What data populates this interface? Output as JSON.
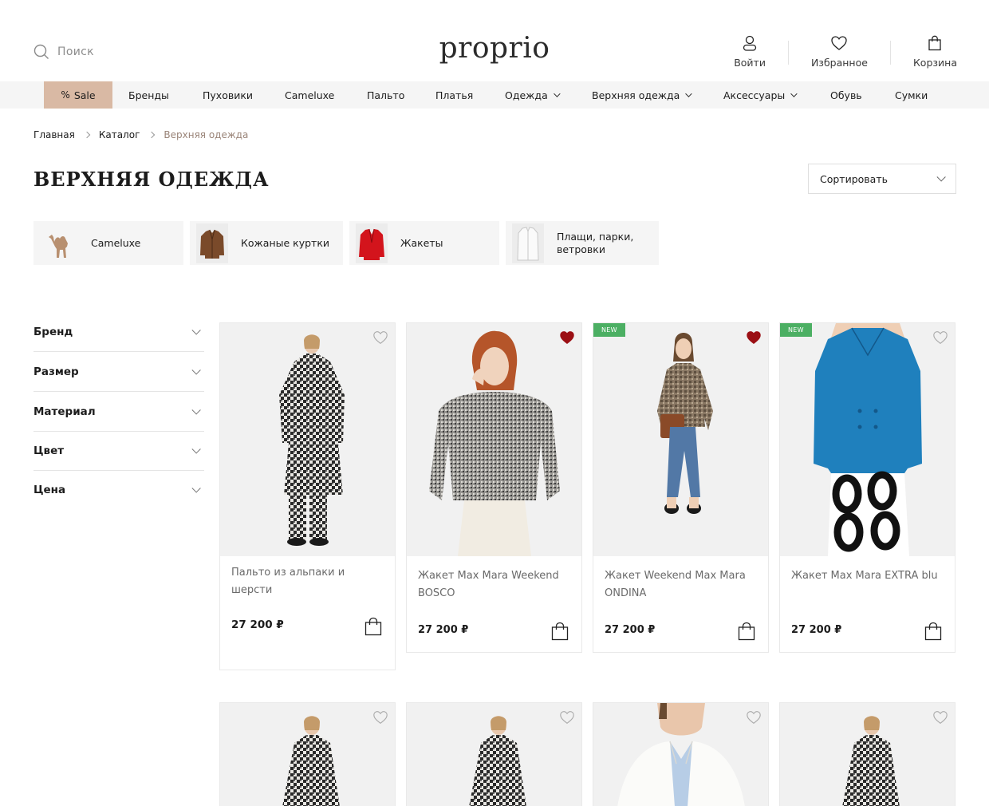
{
  "header": {
    "search_placeholder": "Поиск",
    "logo": "proprio",
    "actions": [
      {
        "label": "Войти",
        "icon": "user-icon"
      },
      {
        "label": "Избранное",
        "icon": "heart-icon"
      },
      {
        "label": "Корзина",
        "icon": "bag-icon"
      }
    ]
  },
  "nav": {
    "sale": "Sale",
    "sale_icon": "percent-icon",
    "items": [
      "Бренды",
      "Пуховики",
      "Cameluxe",
      "Пальто",
      "Платья",
      "Одежда",
      "Верхняя одежда",
      "Аксессуары",
      "Обувь",
      "Сумки"
    ]
  },
  "breadcrumb": [
    "Главная",
    "Каталог",
    "Верхняя одежда"
  ],
  "page_title": "ВЕРХНЯЯ ОДЕЖДА",
  "sort_label": "Сортировать",
  "categories": [
    {
      "label": "Cameluxe",
      "icon": "camel-icon"
    },
    {
      "label": "Кожаные куртки",
      "icon": "leather-jacket-thumb"
    },
    {
      "label": "Жакеты",
      "icon": "red-jacket-thumb"
    },
    {
      "label": "Плащи, парки,",
      "label2": "ветровки",
      "icon": "white-coat-thumb"
    }
  ],
  "filters": [
    "Бренд",
    "Размер",
    "Материал",
    "Цвет",
    "Цена"
  ],
  "products": [
    {
      "name1": "Пальто из альпаки и",
      "name2": "шерсти",
      "price": "27 200 ₽",
      "favorite": false,
      "badge": ""
    },
    {
      "name1": "Жакет Max Mara Weekend",
      "name2": "BOSCO",
      "price": "27 200 ₽",
      "favorite": true,
      "badge": ""
    },
    {
      "name1": "Жакет Weekend Max Mara",
      "name2": "ONDINA",
      "price": "27 200 ₽",
      "favorite": true,
      "badge": "NEW"
    },
    {
      "name1": "Жакет Max Mara EXTRA blu",
      "name2": "",
      "price": "27 200 ₽",
      "favorite": false,
      "badge": "NEW"
    }
  ],
  "colors": {
    "sale_bg": "#d9b9a4",
    "nav_bg": "#f5f5f5",
    "badge_new": "#4caf63",
    "favorite_active": "#9b0f14",
    "breadcrumb_current": "#9a8478"
  }
}
